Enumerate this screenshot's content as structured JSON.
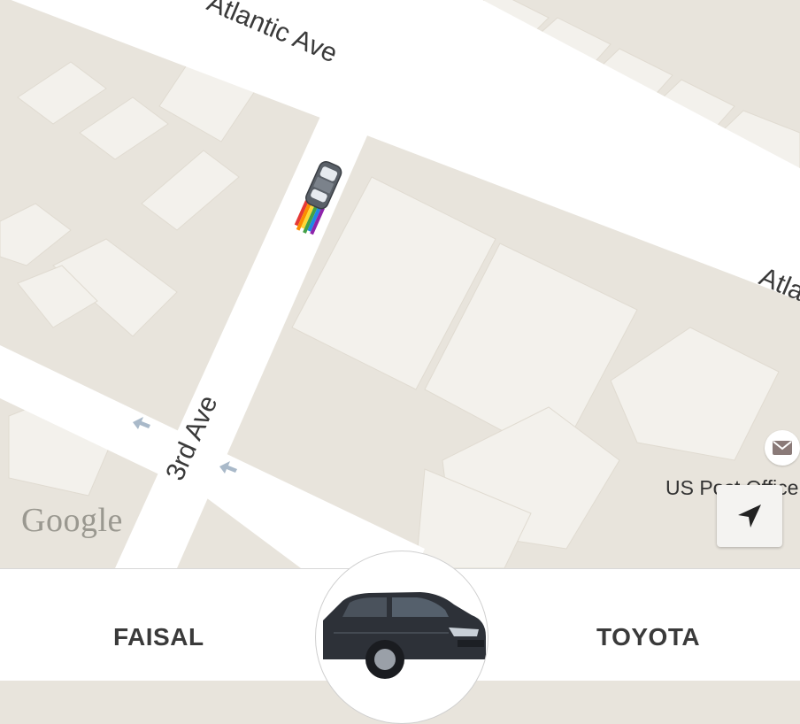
{
  "map": {
    "streets": {
      "atlantic_ave_top": "Atlantic Ave",
      "atlantic_ave_right": "Atla",
      "third_ave": "3rd Ave"
    },
    "attribution": "Google",
    "poi": {
      "label": "US Post Office",
      "icon": "envelope-icon"
    },
    "locate_button": {
      "icon": "navigation-arrow-icon"
    },
    "vehicle_marker": {
      "icon": "car-top-view-icon"
    }
  },
  "trip": {
    "driver_name": "FAISAL",
    "car_make": "TOYOTA",
    "vehicle_photo": {
      "icon": "sedan-car-icon"
    }
  },
  "colors": {
    "map_background": "#e8e4dc",
    "block": "#ebe7df",
    "building": "#f3f1ec",
    "road": "#ffffff",
    "text": "#3a3a3a"
  }
}
